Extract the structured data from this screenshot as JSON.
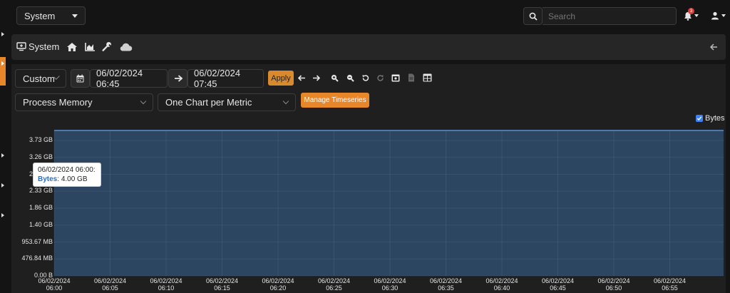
{
  "topbar": {
    "context_select": "System",
    "search_placeholder": "Search",
    "notification_count": "3"
  },
  "header": {
    "title": "System"
  },
  "toolbar": {
    "range_select": "Custom",
    "date_from": "06/02/2024 06:45",
    "date_to": "06/02/2024 07:45",
    "apply_label": "Apply",
    "metric_select": "Process Memory",
    "layout_select": "One Chart per Metric",
    "manage_label": "Manage Timeseries"
  },
  "colors": {
    "accent": "#e8862a",
    "area_fill": "#2c4560",
    "area_line": "#5b8fd0",
    "badge": "#e23b3b"
  },
  "chart_data": {
    "type": "area",
    "title": "",
    "xlabel": "",
    "ylabel": "",
    "legend": [
      "Bytes"
    ],
    "legend_position": "top-right",
    "y_tick_labels": [
      "0.00 B",
      "476.84 MB",
      "953.67 MB",
      "1.40 GB",
      "1.86 GB",
      "2.33 GB",
      "2.79 GB",
      "3.26 GB",
      "3.73 GB"
    ],
    "y_ticks_gb": [
      0,
      0.4657,
      0.9313,
      1.397,
      1.863,
      2.328,
      2.794,
      3.26,
      3.725
    ],
    "ylim_gb": [
      0,
      4.0
    ],
    "x_tick_labels": [
      [
        "06/02/2024",
        "06:00"
      ],
      [
        "06/02/2024",
        "06:05"
      ],
      [
        "06/02/2024",
        "06:10"
      ],
      [
        "06/02/2024",
        "06:15"
      ],
      [
        "06/02/2024",
        "06:20"
      ],
      [
        "06/02/2024",
        "06:25"
      ],
      [
        "06/02/2024",
        "06:30"
      ],
      [
        "06/02/2024",
        "06:35"
      ],
      [
        "06/02/2024",
        "06:40"
      ],
      [
        "06/02/2024",
        "06:45"
      ],
      [
        "06/02/2024",
        "06:50"
      ],
      [
        "06/02/2024",
        "06:55"
      ]
    ],
    "series": [
      {
        "name": "Bytes",
        "x": [
          "06:00",
          "06:59"
        ],
        "values_gb": [
          4.0,
          4.0
        ]
      }
    ],
    "tooltip": {
      "time": "06/02/2024 06:00:",
      "label": "Bytes",
      "value": "4.00 GB"
    },
    "grid": true
  }
}
